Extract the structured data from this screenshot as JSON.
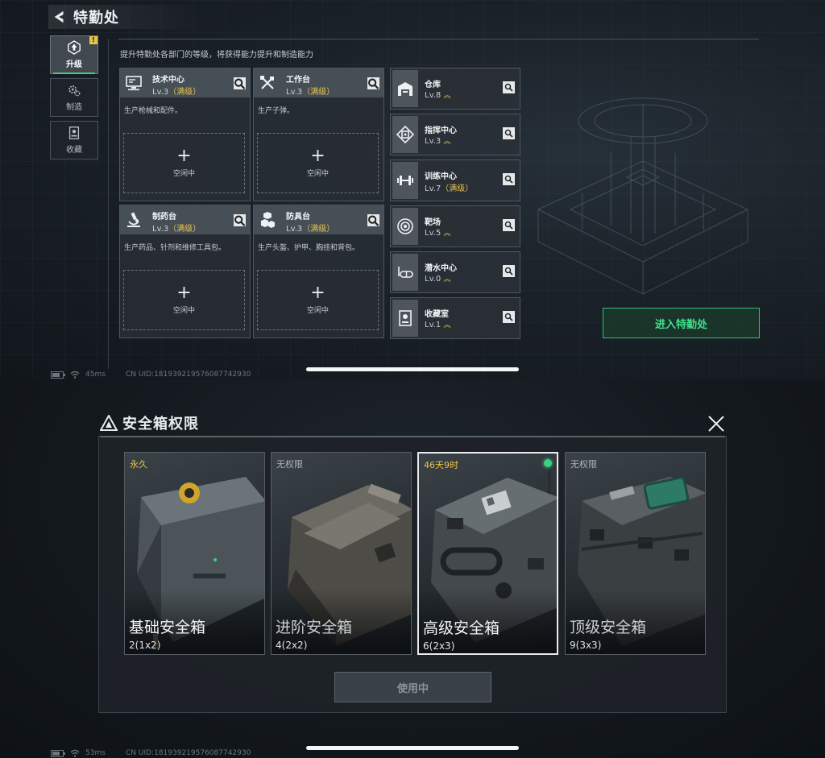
{
  "top": {
    "title": "特勤处",
    "nav": [
      {
        "label": "升级",
        "icon": "upgrade-icon",
        "active": true,
        "badge": "!"
      },
      {
        "label": "制造",
        "icon": "gears-icon",
        "active": false
      },
      {
        "label": "收藏",
        "icon": "collection-icon",
        "active": false
      }
    ],
    "description": "提升特勤处各部门的等级，将获得能力提升和制造能力",
    "workstations": [
      {
        "name": "技术中心",
        "level": "Lv.3",
        "max": "（满级）",
        "desc": "生产枪械和配件。",
        "slot_plus": "+",
        "slot_status": "空闲中",
        "icon": "monitor-icon"
      },
      {
        "name": "工作台",
        "level": "Lv.3",
        "max": "（满级）",
        "desc": "生产子弹。",
        "slot_plus": "+",
        "slot_status": "空闲中",
        "icon": "tools-icon"
      },
      {
        "name": "制药台",
        "level": "Lv.3",
        "max": "（满级）",
        "desc": "生产药品、针剂和维修工具包。",
        "slot_plus": "+",
        "slot_status": "空闲中",
        "icon": "microscope-icon"
      },
      {
        "name": "防具台",
        "level": "Lv.3",
        "max": "（满级）",
        "desc": "生产头盔、护甲、胸挂和背包。",
        "slot_plus": "+",
        "slot_status": "空闲中",
        "icon": "armor-icon"
      }
    ],
    "departments": [
      {
        "name": "仓库",
        "level": "Lv.8",
        "suffix": "",
        "upgradable": true,
        "icon": "warehouse-icon"
      },
      {
        "name": "指挥中心",
        "level": "Lv.3",
        "suffix": "",
        "upgradable": true,
        "icon": "chip-icon"
      },
      {
        "name": "训练中心",
        "level": "Lv.7",
        "suffix": "（满级）",
        "upgradable": false,
        "icon": "dumbbell-icon"
      },
      {
        "name": "靶场",
        "level": "Lv.5",
        "suffix": "",
        "upgradable": true,
        "icon": "target-icon"
      },
      {
        "name": "潜水中心",
        "level": "Lv.0",
        "suffix": "",
        "upgradable": true,
        "icon": "diving-icon"
      },
      {
        "name": "收藏室",
        "level": "Lv.1",
        "suffix": "",
        "upgradable": true,
        "icon": "display-case-icon"
      }
    ],
    "enter_button": "进入特勤处",
    "status": {
      "ping": "45ms",
      "uid": "CN UID:181939219576087742930"
    }
  },
  "bottom": {
    "title": "安全箱权限",
    "cases": [
      {
        "status": "永久",
        "name": "基础安全箱",
        "capacity": "2(1x2)",
        "selected": false,
        "active_dot": false,
        "status_color": "#e8c14b"
      },
      {
        "status": "无权限",
        "name": "进阶安全箱",
        "capacity": "4(2x2)",
        "selected": false,
        "active_dot": false,
        "status_color": "#aeb5bb"
      },
      {
        "status": "46天9时",
        "name": "高级安全箱",
        "capacity": "6(2x3)",
        "selected": true,
        "active_dot": true,
        "status_color": "#e8c14b"
      },
      {
        "status": "无权限",
        "name": "顶级安全箱",
        "capacity": "9(3x3)",
        "selected": false,
        "active_dot": false,
        "status_color": "#aeb5bb"
      }
    ],
    "use_button": "使用中",
    "status": {
      "ping": "53ms",
      "uid": "CN UID:181939219576087742930"
    }
  }
}
